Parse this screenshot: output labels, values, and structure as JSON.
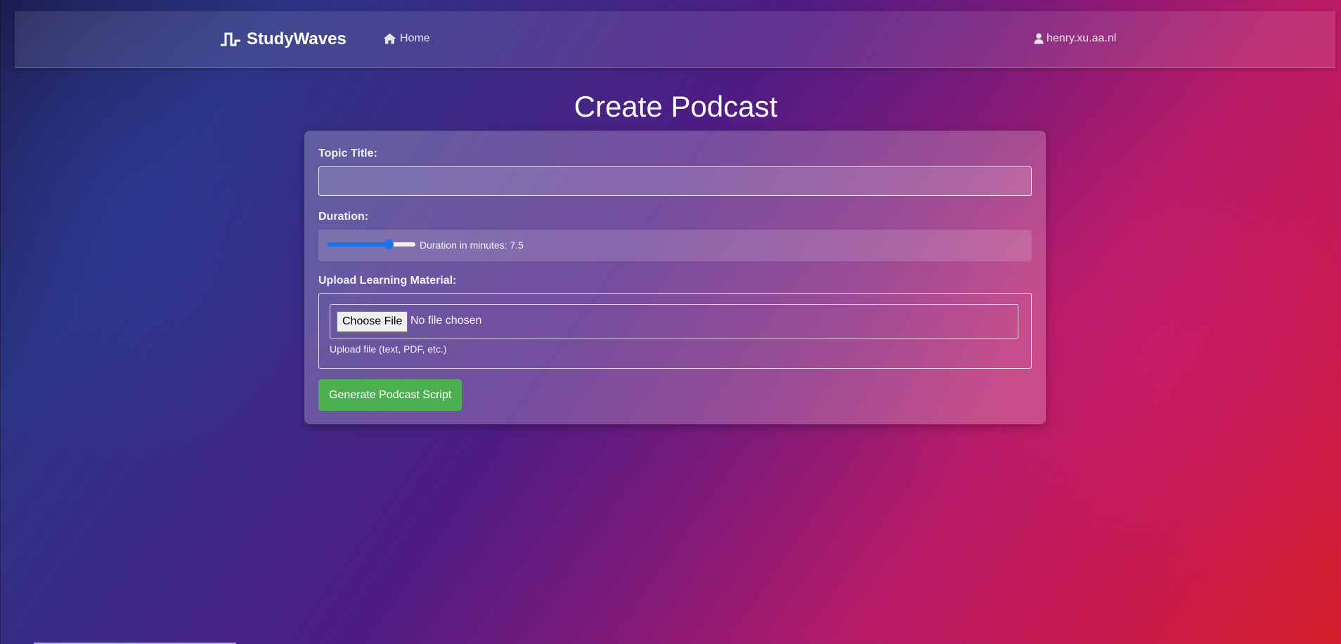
{
  "nav": {
    "brand": "StudyWaves",
    "brand_icon": "pulse-wave-icon",
    "home_label": "Home",
    "home_icon": "home-icon",
    "user_label": "henry.xu.aa.nl",
    "user_icon": "user-icon"
  },
  "page": {
    "title": "Create Podcast"
  },
  "form": {
    "topic_label": "Topic Title:",
    "topic_value": "",
    "duration_label": "Duration:",
    "duration_text": "Duration in minutes: 7.5",
    "duration_slider_fraction": 0.7,
    "upload_label": "Upload Learning Material:",
    "choose_file_label": "Choose File",
    "no_file_text": "No file chosen",
    "upload_hint": "Upload file (text, PDF, etc.)",
    "submit_label": "Generate Podcast Script"
  },
  "colors": {
    "accent_blue": "#1a73e8",
    "button_green": "#4caf50"
  }
}
